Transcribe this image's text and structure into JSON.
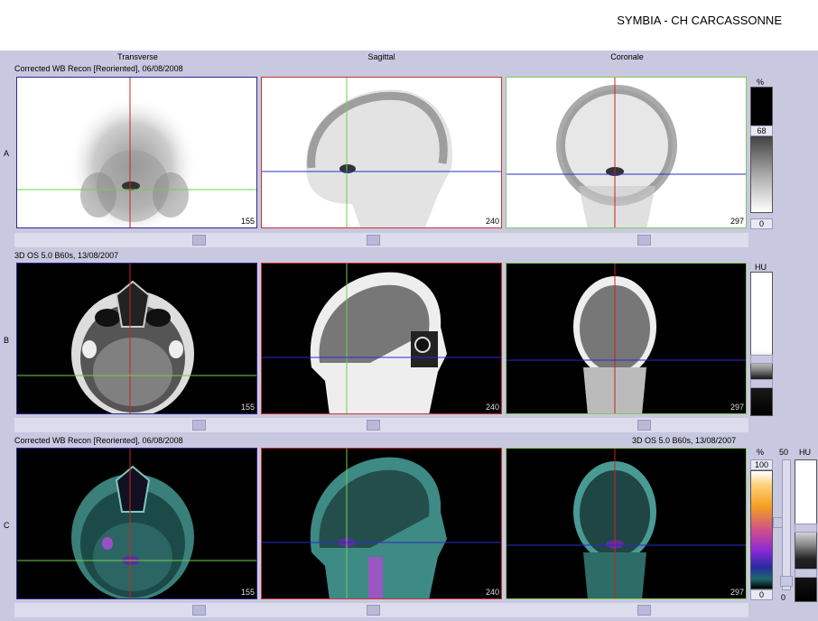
{
  "header": {
    "title": "SYMBIA - CH CARCASSONNE"
  },
  "columns": [
    "Transverse",
    "Sagittal",
    "Coronale"
  ],
  "rows": {
    "A": {
      "label": "A",
      "info": "Corrected WB Recon [Reoriented], 06/08/2008",
      "slices": [
        "155",
        "240",
        "297"
      ]
    },
    "B": {
      "label": "B",
      "info": "3D  OS  5.0  B60s, 13/08/2007",
      "slices": [
        "155",
        "240",
        "297"
      ]
    },
    "C": {
      "label": "C",
      "info_left": "Corrected WB Recon [Reoriented], 06/08/2008",
      "info_right": "3D  OS  5.0  B60s, 13/08/2007",
      "slices": [
        "155",
        "240",
        "297"
      ]
    }
  },
  "scales": {
    "pet": {
      "unit": "%",
      "value": "68",
      "min": "0"
    },
    "ct": {
      "unit": "HU"
    },
    "fusion": {
      "unit": "%",
      "max": "100",
      "min": "0",
      "blend_max": "50",
      "blend_min": "0",
      "ct_unit": "HU"
    }
  },
  "colors": {
    "crosshair_vertical_transverse": "#cc2222",
    "crosshair_horizontal": "#2b2bd0",
    "crosshair_green": "#6fd04a",
    "frame_red": "#cc3333",
    "frame_green": "#88c858"
  }
}
